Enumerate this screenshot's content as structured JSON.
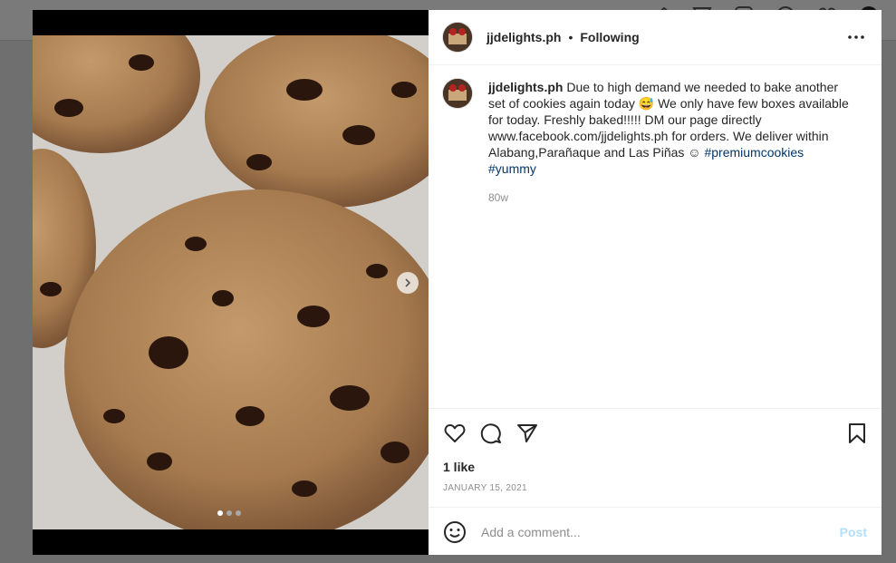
{
  "post": {
    "username": "jjdelights.ph",
    "separator": "•",
    "follow_status": "Following",
    "caption_text": "Due to high demand we needed to bake another set of cookies again today 😅 We only have few boxes available for today. Freshly baked!!!!! DM our page directly www.facebook.com/jjdelights.ph for orders. We deliver within Alabang,Parañaque and Las Piñas ☺",
    "hashtags": [
      "#premiumcookies",
      "#yummy"
    ],
    "time_ago": "80w",
    "likes": "1 like",
    "date": "JANUARY 15, 2021"
  },
  "media": {
    "image_count": 3,
    "active_index": 0
  },
  "comment": {
    "placeholder": "Add a comment...",
    "post_label": "Post"
  },
  "colors": {
    "accent_link": "#00376b",
    "post_disabled": "#b2dffc",
    "muted": "#8e8e8e"
  },
  "icons": [
    "more-icon",
    "heart-icon",
    "comment-icon",
    "share-icon",
    "bookmark-icon",
    "emoji-icon",
    "chevron-right-icon"
  ]
}
